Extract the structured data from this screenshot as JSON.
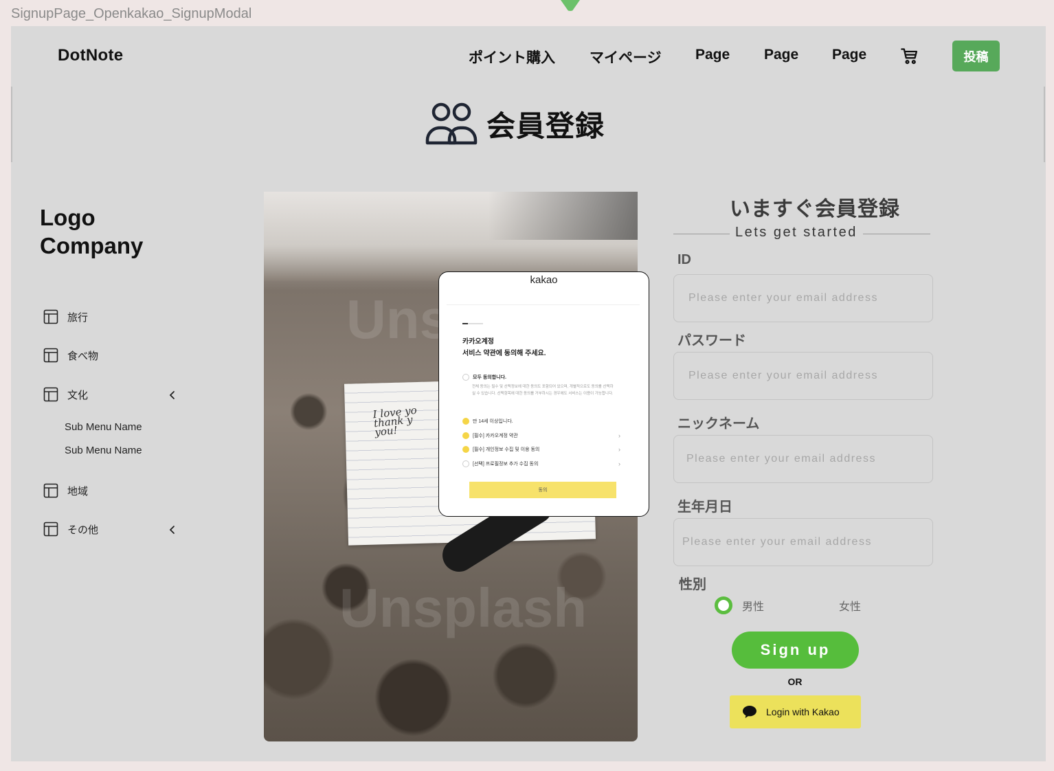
{
  "frame_label": "SignupPage_Openkakao_SignupModal",
  "header": {
    "brand": "DotNote",
    "nav": [
      "ポイント購入",
      "マイページ",
      "Page",
      "Page",
      "Page"
    ],
    "post_label": "投稿"
  },
  "page_title": "会員登録",
  "sidebar": {
    "logo": "Logo Company",
    "items": [
      {
        "label": "旅行"
      },
      {
        "label": "食べ物"
      },
      {
        "label": "文化"
      },
      {
        "label": "地域"
      },
      {
        "label": "その他"
      }
    ],
    "sub_items": [
      "Sub Menu Name",
      "Sub Menu Name"
    ]
  },
  "photo": {
    "handwriting": [
      "I love yo",
      "thank y",
      "you!"
    ],
    "watermark": "Unsplash"
  },
  "kakao_modal": {
    "title": "kakao",
    "heading_1": "카카오계정",
    "heading_2": "서비스 약관에 동의해 주세요.",
    "all_agree": "모두 동의합니다.",
    "all_agree_desc": "전체 동의는 필수 및 선택정보에 대한 동의도 포함되어 있으며, 개별적으로도 동의를 선택하실 수 있습니다. 선택항목에 대한 동의를 거부하시는 경우에도 서비스는 이용이 가능합니다.",
    "rows": [
      "만 14세 이상입니다.",
      "[필수] 카카오계정 약관",
      "[필수] 개인정보 수집 및 이용 동의",
      "[선택] 프로필정보 추가 수집 동의"
    ],
    "agree_button": "동의"
  },
  "form": {
    "title": "いますぐ会員登録",
    "subtitle": "Lets get started",
    "id_label": "ID",
    "password_label": "パスワード",
    "nickname_label": "ニックネーム",
    "birth_label": "生年月日",
    "gender_label": "性別",
    "placeholder": "Please enter your email address",
    "gender_male": "男性",
    "gender_female": "女性",
    "signup_label": "Sign up",
    "or_label": "OR",
    "kakao_label": "Login with Kakao"
  },
  "colors": {
    "accent_green": "#56bd3c",
    "post_green": "#57a95a",
    "kakao_yellow": "#ece15b"
  }
}
